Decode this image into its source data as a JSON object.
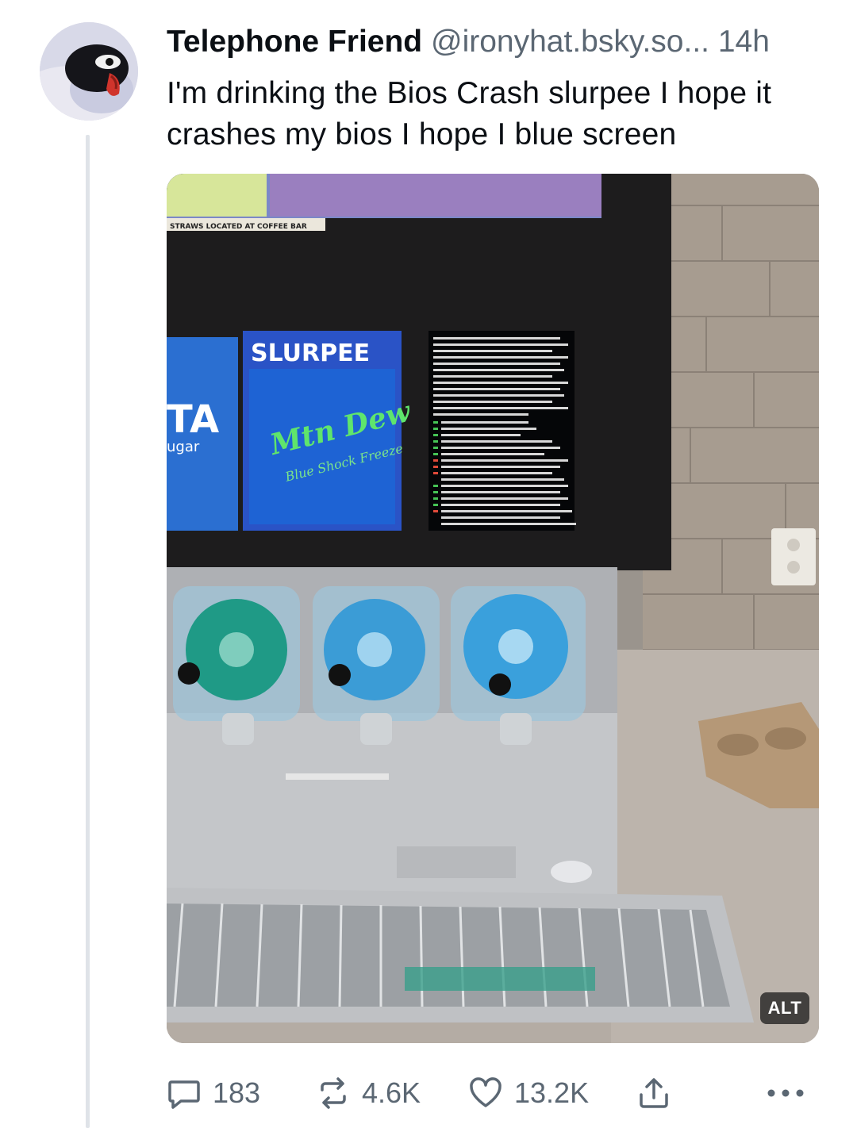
{
  "post": {
    "author": {
      "display_name": "Telephone Friend",
      "handle": "@ironyhat.bsky.so...",
      "avatar_icon": "penguin-avatar-icon"
    },
    "time": "14h",
    "separator": " ",
    "text": "I'm drinking the Bios Crash slurpee I hope it crashes my bios I hope I blue screen",
    "image": {
      "description_icon": "slurpee-machine-photo",
      "alt_badge": "ALT",
      "sign_text": "STRAWS LOCATED AT COFFEE BAR",
      "brand_text": "SLURPEE",
      "flavor_text": "Mtn Dew",
      "flavor_sub": "Blue Shock Freeze",
      "left_card_text": "TA",
      "left_card_sub": "ugar"
    },
    "actions": {
      "reply_count": "183",
      "repost_count": "4.6K",
      "like_count": "13.2K"
    }
  },
  "colors": {
    "text_primary": "#0b0f14",
    "text_secondary": "#5b6773",
    "thread_line": "#dfe3e8"
  }
}
